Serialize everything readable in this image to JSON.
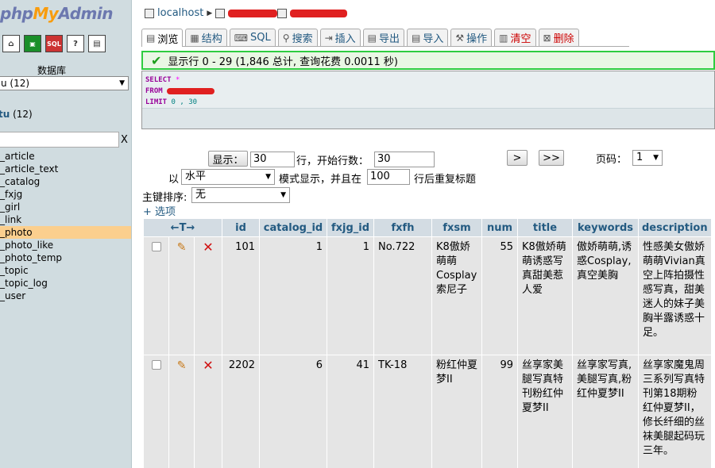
{
  "nav": {
    "logo": {
      "php": "php",
      "my": "My",
      "admin": "Admin"
    },
    "icons": [
      "home-icon",
      "exit-icon",
      "sql-window-icon",
      "help-icon",
      "docs-icon"
    ],
    "db_label": "数据库",
    "db_select_value": "u (12)",
    "db_name": "tu",
    "db_count": "(12)",
    "filter_clear": "X",
    "tables": [
      "_article",
      "_article_text",
      "_catalog",
      "_fxjg",
      "_girl",
      "_link",
      "_photo",
      "_photo_like",
      "_photo_temp",
      "_topic",
      "_topic_log",
      "_user"
    ],
    "active_table": "_photo"
  },
  "breadcrumb": {
    "server": "localhost"
  },
  "tabs": [
    {
      "label": "浏览",
      "icon": "browse-icon",
      "glyph": "▤"
    },
    {
      "label": "结构",
      "icon": "structure-icon",
      "glyph": "▦"
    },
    {
      "label": "SQL",
      "icon": "sql-icon",
      "glyph": "⌨"
    },
    {
      "label": "搜索",
      "icon": "search-icon",
      "glyph": "⚲"
    },
    {
      "label": "插入",
      "icon": "insert-icon",
      "glyph": "⇥"
    },
    {
      "label": "导出",
      "icon": "export-icon",
      "glyph": "▤"
    },
    {
      "label": "导入",
      "icon": "import-icon",
      "glyph": "▤"
    },
    {
      "label": "操作",
      "icon": "operations-icon",
      "glyph": "⚒"
    },
    {
      "label": "清空",
      "icon": "empty-icon",
      "glyph": "▥"
    },
    {
      "label": "删除",
      "icon": "drop-icon",
      "glyph": "⊠"
    }
  ],
  "success_message": "显示行 0 - 29 (1,846 总计, 查询花费 0.0011 秒)",
  "sql": {
    "select": "SELECT",
    "star": "*",
    "from": "FROM",
    "limit": "LIMIT",
    "offset": "0",
    "comma": ",",
    "count": "30"
  },
  "navigation": {
    "show_button": "显示：",
    "rows_value": "30",
    "rows_label": "行，开始行数：",
    "start_value": "30",
    "next_button": ">",
    "last_button": ">>",
    "page_label": "页码：",
    "page_value": "1",
    "mode_prefix": "以",
    "mode_value": "水平",
    "mode_label": "模式显示，并且在",
    "repeat_value": "100",
    "repeat_label": "行后重复标题",
    "sort_label": "主键排序:",
    "sort_value": "无"
  },
  "options_link": "+ 选项",
  "table": {
    "col_arrows": "←T→",
    "columns": [
      "id",
      "catalog_id",
      "fxjg_id",
      "fxfh",
      "fxsm",
      "num",
      "title",
      "keywords",
      "description"
    ],
    "rows": [
      {
        "id": "101",
        "catalog_id": "1",
        "fxjg_id": "1",
        "fxfh": "No.722",
        "fxsm": "K8傲娇萌萌Cosplay索尼子",
        "num": "55",
        "title": "K8傲娇萌萌诱惑写真甜美惹人爱",
        "keywords": "傲娇萌萌,诱惑Cosplay,真空美胸",
        "description": "性感美女傲娇萌萌Vivian真空上阵拍摄性感写真，甜美迷人的妹子美胸半露诱惑十足。"
      },
      {
        "id": "2202",
        "catalog_id": "6",
        "fxjg_id": "41",
        "fxfh": "TK-18",
        "fxsm": "粉红仲夏梦II",
        "num": "99",
        "title": "丝享家美腿写真特刊粉红仲夏梦II",
        "keywords": "丝享家写真,美腿写真,粉红仲夏梦II",
        "description": "丝享家魔鬼周三系列写真特刊第18期粉红仲夏梦II，修长纤细的丝袜美腿起码玩三年。"
      }
    ]
  },
  "colors": {
    "nav_bg": "#d0dce0",
    "active_table": "#fbcf8e",
    "success_border": "#2ecc40",
    "header_bg": "#d3dce3",
    "cell_bg": "#e5e5e5",
    "link": "#235a81"
  }
}
